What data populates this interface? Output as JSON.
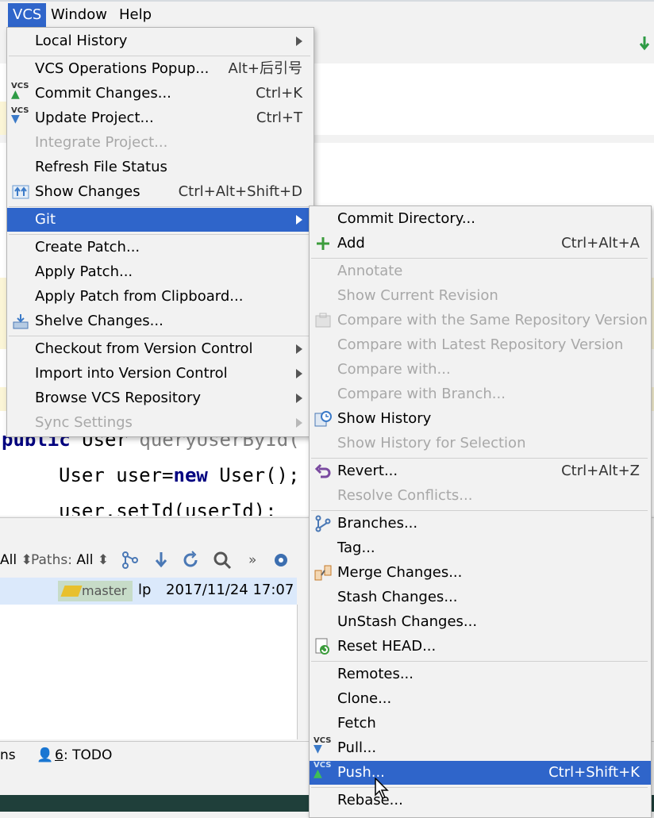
{
  "menubar": {
    "vcs": "VCS",
    "window": "Window",
    "help": "Help"
  },
  "editor": {
    "line_public": "public",
    "line_user": "User",
    "line_method": "queryUserById(",
    "line2_a": "User user=",
    "line2_new": "new",
    "line2_b": " User();",
    "line3": "user.setId(userId);"
  },
  "log": {
    "all_label": "All",
    "paths_label": "Paths:",
    "paths_value": "All",
    "branch_tag": "master",
    "author": "lp",
    "date": "2017/11/24 17:07"
  },
  "statusbar": {
    "left_fragment": "ns",
    "todo_num": "6",
    "todo_label": ": TODO"
  },
  "vcs_menu": {
    "local_history": "Local History",
    "operations_popup": "VCS Operations Popup...",
    "operations_popup_sc": "Alt+后引号",
    "commit_changes": "Commit Changes...",
    "commit_changes_sc": "Ctrl+K",
    "update_project": "Update Project...",
    "update_project_sc": "Ctrl+T",
    "integrate_project": "Integrate Project...",
    "refresh_file_status": "Refresh File Status",
    "show_changes": "Show Changes",
    "show_changes_sc": "Ctrl+Alt+Shift+D",
    "git": "Git",
    "create_patch": "Create Patch...",
    "apply_patch": "Apply Patch...",
    "apply_patch_clipboard": "Apply Patch from Clipboard...",
    "shelve_changes": "Shelve Changes...",
    "checkout_vc": "Checkout from Version Control",
    "import_vc": "Import into Version Control",
    "browse_repo": "Browse VCS Repository",
    "sync_settings": "Sync Settings"
  },
  "git_menu": {
    "commit_directory": "Commit Directory...",
    "add": "Add",
    "add_sc": "Ctrl+Alt+A",
    "annotate": "Annotate",
    "show_current_revision": "Show Current Revision",
    "compare_same_repo": "Compare with the Same Repository Version",
    "compare_latest_repo": "Compare with Latest Repository Version",
    "compare_with": "Compare with...",
    "compare_with_branch": "Compare with Branch...",
    "show_history": "Show History",
    "show_history_selection": "Show History for Selection",
    "revert": "Revert...",
    "revert_sc": "Ctrl+Alt+Z",
    "resolve_conflicts": "Resolve Conflicts...",
    "branches": "Branches...",
    "tag": "Tag...",
    "merge_changes": "Merge Changes...",
    "stash_changes": "Stash Changes...",
    "unstash_changes": "UnStash Changes...",
    "reset_head": "Reset HEAD...",
    "remotes": "Remotes...",
    "clone": "Clone...",
    "fetch": "Fetch",
    "pull": "Pull...",
    "push": "Push...",
    "push_sc": "Ctrl+Shift+K",
    "rebase": "Rebase..."
  },
  "icon_label": "VCS",
  "colors": {
    "selection": "#2f65ca",
    "menu_bg": "#f2f2f2",
    "disabled": "#a8a8a8"
  }
}
